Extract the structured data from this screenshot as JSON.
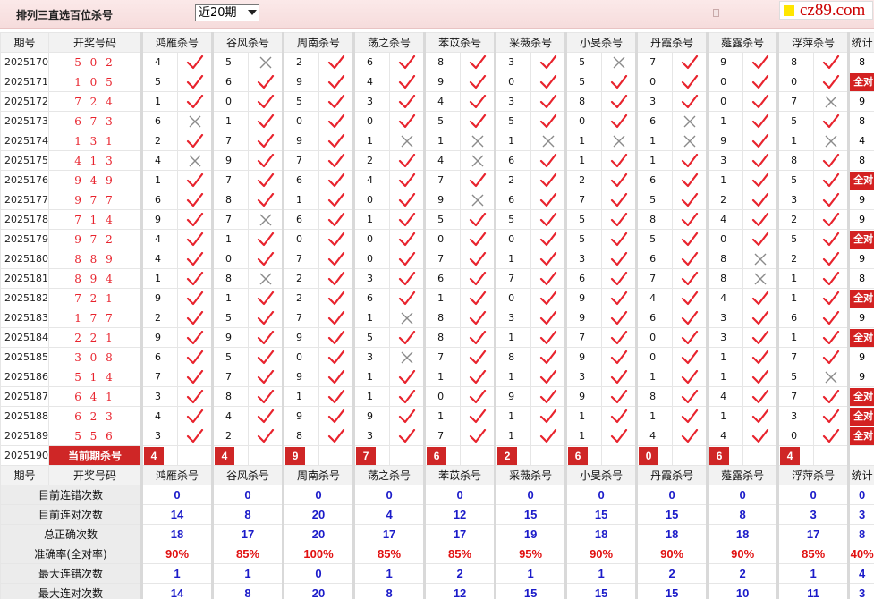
{
  "header": {
    "title": "排列三直选百位杀号",
    "period_select": "近20期"
  },
  "logo": {
    "text": "cz89.com"
  },
  "columns": {
    "period": "期号",
    "draw": "开奖号码",
    "predictors": [
      "鸿雁杀号",
      "谷风杀号",
      "周南杀号",
      "荡之杀号",
      "苯苡杀号",
      "采薇杀号",
      "小旻杀号",
      "丹霞杀号",
      "薤露杀号",
      "浮萍杀号"
    ],
    "stat": "统计"
  },
  "rows": [
    {
      "period": "2025170",
      "draw": "5 0 2",
      "kills": [
        [
          "4",
          "ok"
        ],
        [
          "5",
          "bad"
        ],
        [
          "2",
          "ok"
        ],
        [
          "6",
          "ok"
        ],
        [
          "8",
          "ok"
        ],
        [
          "3",
          "ok"
        ],
        [
          "5",
          "bad"
        ],
        [
          "7",
          "ok"
        ],
        [
          "9",
          "ok"
        ],
        [
          "8",
          "ok"
        ]
      ],
      "stat": "8"
    },
    {
      "period": "2025171",
      "draw": "1 0 5",
      "kills": [
        [
          "5",
          "ok"
        ],
        [
          "6",
          "ok"
        ],
        [
          "9",
          "ok"
        ],
        [
          "4",
          "ok"
        ],
        [
          "9",
          "ok"
        ],
        [
          "0",
          "ok"
        ],
        [
          "5",
          "ok"
        ],
        [
          "0",
          "ok"
        ],
        [
          "0",
          "ok"
        ],
        [
          "0",
          "ok"
        ]
      ],
      "stat": "全对"
    },
    {
      "period": "2025172",
      "draw": "7 2 4",
      "kills": [
        [
          "1",
          "ok"
        ],
        [
          "0",
          "ok"
        ],
        [
          "5",
          "ok"
        ],
        [
          "3",
          "ok"
        ],
        [
          "4",
          "ok"
        ],
        [
          "3",
          "ok"
        ],
        [
          "8",
          "ok"
        ],
        [
          "3",
          "ok"
        ],
        [
          "0",
          "ok"
        ],
        [
          "7",
          "bad"
        ]
      ],
      "stat": "9"
    },
    {
      "period": "2025173",
      "draw": "6 7 3",
      "kills": [
        [
          "6",
          "bad"
        ],
        [
          "1",
          "ok"
        ],
        [
          "0",
          "ok"
        ],
        [
          "0",
          "ok"
        ],
        [
          "5",
          "ok"
        ],
        [
          "5",
          "ok"
        ],
        [
          "0",
          "ok"
        ],
        [
          "6",
          "bad"
        ],
        [
          "1",
          "ok"
        ],
        [
          "5",
          "ok"
        ]
      ],
      "stat": "8"
    },
    {
      "period": "2025174",
      "draw": "1 3 1",
      "kills": [
        [
          "2",
          "ok"
        ],
        [
          "7",
          "ok"
        ],
        [
          "9",
          "ok"
        ],
        [
          "1",
          "bad"
        ],
        [
          "1",
          "bad"
        ],
        [
          "1",
          "bad"
        ],
        [
          "1",
          "bad"
        ],
        [
          "1",
          "bad"
        ],
        [
          "9",
          "ok"
        ],
        [
          "1",
          "bad"
        ]
      ],
      "stat": "4"
    },
    {
      "period": "2025175",
      "draw": "4 1 3",
      "kills": [
        [
          "4",
          "bad"
        ],
        [
          "9",
          "ok"
        ],
        [
          "7",
          "ok"
        ],
        [
          "2",
          "ok"
        ],
        [
          "4",
          "bad"
        ],
        [
          "6",
          "ok"
        ],
        [
          "1",
          "ok"
        ],
        [
          "1",
          "ok"
        ],
        [
          "3",
          "ok"
        ],
        [
          "8",
          "ok"
        ]
      ],
      "stat": "8"
    },
    {
      "period": "2025176",
      "draw": "9 4 9",
      "kills": [
        [
          "1",
          "ok"
        ],
        [
          "7",
          "ok"
        ],
        [
          "6",
          "ok"
        ],
        [
          "4",
          "ok"
        ],
        [
          "7",
          "ok"
        ],
        [
          "2",
          "ok"
        ],
        [
          "2",
          "ok"
        ],
        [
          "6",
          "ok"
        ],
        [
          "1",
          "ok"
        ],
        [
          "5",
          "ok"
        ]
      ],
      "stat": "全对"
    },
    {
      "period": "2025177",
      "draw": "9 7 7",
      "kills": [
        [
          "6",
          "ok"
        ],
        [
          "8",
          "ok"
        ],
        [
          "1",
          "ok"
        ],
        [
          "0",
          "ok"
        ],
        [
          "9",
          "bad"
        ],
        [
          "6",
          "ok"
        ],
        [
          "7",
          "ok"
        ],
        [
          "5",
          "ok"
        ],
        [
          "2",
          "ok"
        ],
        [
          "3",
          "ok"
        ]
      ],
      "stat": "9"
    },
    {
      "period": "2025178",
      "draw": "7 1 4",
      "kills": [
        [
          "9",
          "ok"
        ],
        [
          "7",
          "bad"
        ],
        [
          "6",
          "ok"
        ],
        [
          "1",
          "ok"
        ],
        [
          "5",
          "ok"
        ],
        [
          "5",
          "ok"
        ],
        [
          "5",
          "ok"
        ],
        [
          "8",
          "ok"
        ],
        [
          "4",
          "ok"
        ],
        [
          "2",
          "ok"
        ]
      ],
      "stat": "9"
    },
    {
      "period": "2025179",
      "draw": "9 7 2",
      "kills": [
        [
          "4",
          "ok"
        ],
        [
          "1",
          "ok"
        ],
        [
          "0",
          "ok"
        ],
        [
          "0",
          "ok"
        ],
        [
          "0",
          "ok"
        ],
        [
          "0",
          "ok"
        ],
        [
          "5",
          "ok"
        ],
        [
          "5",
          "ok"
        ],
        [
          "0",
          "ok"
        ],
        [
          "5",
          "ok"
        ]
      ],
      "stat": "全对"
    },
    {
      "period": "2025180",
      "draw": "8 8 9",
      "kills": [
        [
          "4",
          "ok"
        ],
        [
          "0",
          "ok"
        ],
        [
          "7",
          "ok"
        ],
        [
          "0",
          "ok"
        ],
        [
          "7",
          "ok"
        ],
        [
          "1",
          "ok"
        ],
        [
          "3",
          "ok"
        ],
        [
          "6",
          "ok"
        ],
        [
          "8",
          "bad"
        ],
        [
          "2",
          "ok"
        ]
      ],
      "stat": "9"
    },
    {
      "period": "2025181",
      "draw": "8 9 4",
      "kills": [
        [
          "1",
          "ok"
        ],
        [
          "8",
          "bad"
        ],
        [
          "2",
          "ok"
        ],
        [
          "3",
          "ok"
        ],
        [
          "6",
          "ok"
        ],
        [
          "7",
          "ok"
        ],
        [
          "6",
          "ok"
        ],
        [
          "7",
          "ok"
        ],
        [
          "8",
          "bad"
        ],
        [
          "1",
          "ok"
        ]
      ],
      "stat": "8"
    },
    {
      "period": "2025182",
      "draw": "7 2 1",
      "kills": [
        [
          "9",
          "ok"
        ],
        [
          "1",
          "ok"
        ],
        [
          "2",
          "ok"
        ],
        [
          "6",
          "ok"
        ],
        [
          "1",
          "ok"
        ],
        [
          "0",
          "ok"
        ],
        [
          "9",
          "ok"
        ],
        [
          "4",
          "ok"
        ],
        [
          "4",
          "ok"
        ],
        [
          "1",
          "ok"
        ]
      ],
      "stat": "全对"
    },
    {
      "period": "2025183",
      "draw": "1 7 7",
      "kills": [
        [
          "2",
          "ok"
        ],
        [
          "5",
          "ok"
        ],
        [
          "7",
          "ok"
        ],
        [
          "1",
          "bad"
        ],
        [
          "8",
          "ok"
        ],
        [
          "3",
          "ok"
        ],
        [
          "9",
          "ok"
        ],
        [
          "6",
          "ok"
        ],
        [
          "3",
          "ok"
        ],
        [
          "6",
          "ok"
        ]
      ],
      "stat": "9"
    },
    {
      "period": "2025184",
      "draw": "2 2 1",
      "kills": [
        [
          "9",
          "ok"
        ],
        [
          "9",
          "ok"
        ],
        [
          "9",
          "ok"
        ],
        [
          "5",
          "ok"
        ],
        [
          "8",
          "ok"
        ],
        [
          "1",
          "ok"
        ],
        [
          "7",
          "ok"
        ],
        [
          "0",
          "ok"
        ],
        [
          "3",
          "ok"
        ],
        [
          "1",
          "ok"
        ]
      ],
      "stat": "全对"
    },
    {
      "period": "2025185",
      "draw": "3 0 8",
      "kills": [
        [
          "6",
          "ok"
        ],
        [
          "5",
          "ok"
        ],
        [
          "0",
          "ok"
        ],
        [
          "3",
          "bad"
        ],
        [
          "7",
          "ok"
        ],
        [
          "8",
          "ok"
        ],
        [
          "9",
          "ok"
        ],
        [
          "0",
          "ok"
        ],
        [
          "1",
          "ok"
        ],
        [
          "7",
          "ok"
        ]
      ],
      "stat": "9"
    },
    {
      "period": "2025186",
      "draw": "5 1 4",
      "kills": [
        [
          "7",
          "ok"
        ],
        [
          "7",
          "ok"
        ],
        [
          "9",
          "ok"
        ],
        [
          "1",
          "ok"
        ],
        [
          "1",
          "ok"
        ],
        [
          "1",
          "ok"
        ],
        [
          "3",
          "ok"
        ],
        [
          "1",
          "ok"
        ],
        [
          "1",
          "ok"
        ],
        [
          "5",
          "bad"
        ]
      ],
      "stat": "9"
    },
    {
      "period": "2025187",
      "draw": "6 4 1",
      "kills": [
        [
          "3",
          "ok"
        ],
        [
          "8",
          "ok"
        ],
        [
          "1",
          "ok"
        ],
        [
          "1",
          "ok"
        ],
        [
          "0",
          "ok"
        ],
        [
          "9",
          "ok"
        ],
        [
          "9",
          "ok"
        ],
        [
          "8",
          "ok"
        ],
        [
          "4",
          "ok"
        ],
        [
          "7",
          "ok"
        ]
      ],
      "stat": "全对"
    },
    {
      "period": "2025188",
      "draw": "6 2 3",
      "kills": [
        [
          "4",
          "ok"
        ],
        [
          "4",
          "ok"
        ],
        [
          "9",
          "ok"
        ],
        [
          "9",
          "ok"
        ],
        [
          "1",
          "ok"
        ],
        [
          "1",
          "ok"
        ],
        [
          "1",
          "ok"
        ],
        [
          "1",
          "ok"
        ],
        [
          "1",
          "ok"
        ],
        [
          "3",
          "ok"
        ]
      ],
      "stat": "全对"
    },
    {
      "period": "2025189",
      "draw": "5 5 6",
      "kills": [
        [
          "3",
          "ok"
        ],
        [
          "2",
          "ok"
        ],
        [
          "8",
          "ok"
        ],
        [
          "3",
          "ok"
        ],
        [
          "7",
          "ok"
        ],
        [
          "1",
          "ok"
        ],
        [
          "1",
          "ok"
        ],
        [
          "4",
          "ok"
        ],
        [
          "4",
          "ok"
        ],
        [
          "0",
          "ok"
        ]
      ],
      "stat": "全对"
    }
  ],
  "current": {
    "period": "2025190",
    "label": "当前期杀号",
    "kills": [
      "4",
      "4",
      "9",
      "7",
      "6",
      "2",
      "6",
      "0",
      "6",
      "4"
    ]
  },
  "stats": [
    {
      "label": "目前连错次数",
      "values": [
        "0",
        "0",
        "0",
        "0",
        "0",
        "0",
        "0",
        "0",
        "0",
        "0"
      ],
      "stat": "0",
      "color": "blue"
    },
    {
      "label": "目前连对次数",
      "values": [
        "14",
        "8",
        "20",
        "4",
        "12",
        "15",
        "15",
        "15",
        "8",
        "3"
      ],
      "stat": "3",
      "color": "blue"
    },
    {
      "label": "总正确次数",
      "values": [
        "18",
        "17",
        "20",
        "17",
        "17",
        "19",
        "18",
        "18",
        "18",
        "17"
      ],
      "stat": "8",
      "color": "blue"
    },
    {
      "label": "准确率(全对率)",
      "values": [
        "90%",
        "85%",
        "100%",
        "85%",
        "85%",
        "95%",
        "90%",
        "90%",
        "90%",
        "85%"
      ],
      "stat": "40%",
      "color": "red"
    },
    {
      "label": "最大连错次数",
      "values": [
        "1",
        "1",
        "0",
        "1",
        "2",
        "1",
        "1",
        "2",
        "2",
        "1"
      ],
      "stat": "4",
      "color": "blue"
    },
    {
      "label": "最大连对次数",
      "values": [
        "14",
        "8",
        "20",
        "8",
        "12",
        "15",
        "15",
        "15",
        "10",
        "11"
      ],
      "stat": "3",
      "color": "blue"
    }
  ],
  "colors": {
    "accent": "#cf2626",
    "check": "#e8232d",
    "cross": "#8a8a8a",
    "stat_blue": "#1b1bc9",
    "stat_red": "#e11010"
  }
}
